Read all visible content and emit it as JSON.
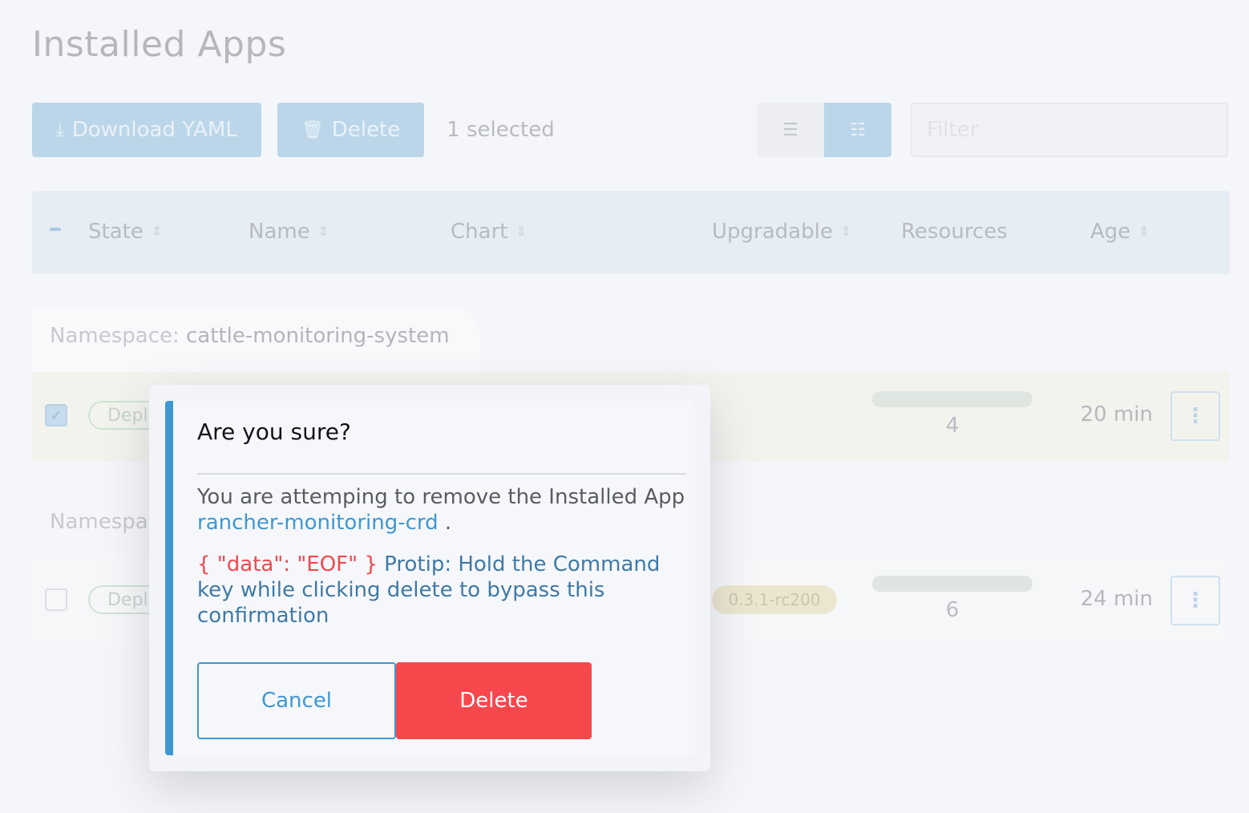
{
  "page": {
    "title": "Installed Apps"
  },
  "toolbar": {
    "download_label": "Download YAML",
    "delete_label": "Delete",
    "selected_text": "1 selected",
    "filter_placeholder": "Filter"
  },
  "table": {
    "columns": [
      "State",
      "Name",
      "Chart",
      "Upgradable",
      "Resources",
      "Age"
    ],
    "groups": [
      {
        "namespace_label": "Namespace:",
        "namespace_value": "cattle-monitoring-system",
        "row": {
          "checked": true,
          "state": "Deployed",
          "resources": "4",
          "age": "20 min"
        }
      },
      {
        "namespace_label": "Namespace:",
        "row": {
          "checked": false,
          "state": "Deployed",
          "upgradable": "0.3.1-rc200",
          "resources": "6",
          "age": "24 min"
        }
      }
    ]
  },
  "modal": {
    "title": "Are you sure?",
    "body_prefix": "You are attemping to remove the Installed App",
    "app_name": "rancher-monitoring-crd",
    "body_suffix": ".",
    "error_text": "{ \"data\": \"EOF\" }",
    "protip": "Protip: Hold the Command key while clicking delete to bypass this confirmation",
    "cancel_label": "Cancel",
    "delete_label": "Delete"
  },
  "colors": {
    "accent": "#3d98d3",
    "danger": "#f6474d",
    "error_text": "#f04850"
  }
}
